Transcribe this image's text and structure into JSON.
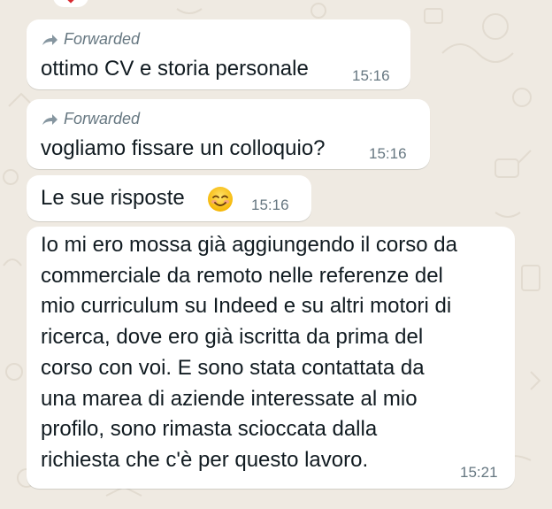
{
  "messages": [
    {
      "forwarded_label": "Forwarded",
      "text": "ottimo CV e storia personale",
      "time": "15:16"
    },
    {
      "forwarded_label": "Forwarded",
      "text": "vogliamo fissare un colloquio?",
      "time": "15:16"
    },
    {
      "text": "Le sue risposte",
      "emoji": "smiling-face-with-smiling-eyes",
      "time": "15:16"
    },
    {
      "lines": [
        "Io mi ero mossa già aggiungendo il corso da",
        "commerciale da remoto nelle referenze del",
        "mio curriculum su Indeed e su altri motori di",
        "ricerca, dove ero già iscritta da prima del",
        "corso con voi. E sono stata contattata da",
        "una marea di aziende interessate al mio",
        "profilo, sono rimasta scioccata dalla",
        "richiesta che c'è per questo lavoro."
      ],
      "time": "15:21"
    }
  ],
  "colors": {
    "chat_background": "#efeae2",
    "bubble": "#ffffff",
    "meta_text": "#667781"
  }
}
